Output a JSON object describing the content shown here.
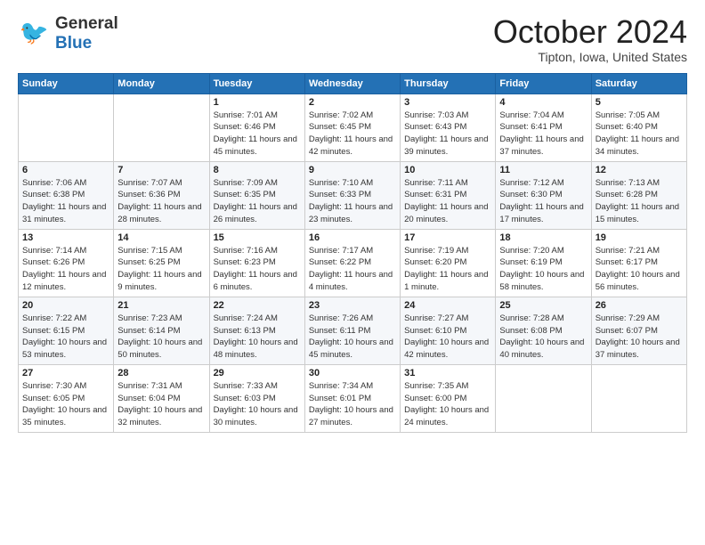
{
  "header": {
    "logo_general": "General",
    "logo_blue": "Blue",
    "month": "October 2024",
    "location": "Tipton, Iowa, United States"
  },
  "weekdays": [
    "Sunday",
    "Monday",
    "Tuesday",
    "Wednesday",
    "Thursday",
    "Friday",
    "Saturday"
  ],
  "weeks": [
    [
      {
        "day": "",
        "sunrise": "",
        "sunset": "",
        "daylight": ""
      },
      {
        "day": "",
        "sunrise": "",
        "sunset": "",
        "daylight": ""
      },
      {
        "day": "1",
        "sunrise": "Sunrise: 7:01 AM",
        "sunset": "Sunset: 6:46 PM",
        "daylight": "Daylight: 11 hours and 45 minutes."
      },
      {
        "day": "2",
        "sunrise": "Sunrise: 7:02 AM",
        "sunset": "Sunset: 6:45 PM",
        "daylight": "Daylight: 11 hours and 42 minutes."
      },
      {
        "day": "3",
        "sunrise": "Sunrise: 7:03 AM",
        "sunset": "Sunset: 6:43 PM",
        "daylight": "Daylight: 11 hours and 39 minutes."
      },
      {
        "day": "4",
        "sunrise": "Sunrise: 7:04 AM",
        "sunset": "Sunset: 6:41 PM",
        "daylight": "Daylight: 11 hours and 37 minutes."
      },
      {
        "day": "5",
        "sunrise": "Sunrise: 7:05 AM",
        "sunset": "Sunset: 6:40 PM",
        "daylight": "Daylight: 11 hours and 34 minutes."
      }
    ],
    [
      {
        "day": "6",
        "sunrise": "Sunrise: 7:06 AM",
        "sunset": "Sunset: 6:38 PM",
        "daylight": "Daylight: 11 hours and 31 minutes."
      },
      {
        "day": "7",
        "sunrise": "Sunrise: 7:07 AM",
        "sunset": "Sunset: 6:36 PM",
        "daylight": "Daylight: 11 hours and 28 minutes."
      },
      {
        "day": "8",
        "sunrise": "Sunrise: 7:09 AM",
        "sunset": "Sunset: 6:35 PM",
        "daylight": "Daylight: 11 hours and 26 minutes."
      },
      {
        "day": "9",
        "sunrise": "Sunrise: 7:10 AM",
        "sunset": "Sunset: 6:33 PM",
        "daylight": "Daylight: 11 hours and 23 minutes."
      },
      {
        "day": "10",
        "sunrise": "Sunrise: 7:11 AM",
        "sunset": "Sunset: 6:31 PM",
        "daylight": "Daylight: 11 hours and 20 minutes."
      },
      {
        "day": "11",
        "sunrise": "Sunrise: 7:12 AM",
        "sunset": "Sunset: 6:30 PM",
        "daylight": "Daylight: 11 hours and 17 minutes."
      },
      {
        "day": "12",
        "sunrise": "Sunrise: 7:13 AM",
        "sunset": "Sunset: 6:28 PM",
        "daylight": "Daylight: 11 hours and 15 minutes."
      }
    ],
    [
      {
        "day": "13",
        "sunrise": "Sunrise: 7:14 AM",
        "sunset": "Sunset: 6:26 PM",
        "daylight": "Daylight: 11 hours and 12 minutes."
      },
      {
        "day": "14",
        "sunrise": "Sunrise: 7:15 AM",
        "sunset": "Sunset: 6:25 PM",
        "daylight": "Daylight: 11 hours and 9 minutes."
      },
      {
        "day": "15",
        "sunrise": "Sunrise: 7:16 AM",
        "sunset": "Sunset: 6:23 PM",
        "daylight": "Daylight: 11 hours and 6 minutes."
      },
      {
        "day": "16",
        "sunrise": "Sunrise: 7:17 AM",
        "sunset": "Sunset: 6:22 PM",
        "daylight": "Daylight: 11 hours and 4 minutes."
      },
      {
        "day": "17",
        "sunrise": "Sunrise: 7:19 AM",
        "sunset": "Sunset: 6:20 PM",
        "daylight": "Daylight: 11 hours and 1 minute."
      },
      {
        "day": "18",
        "sunrise": "Sunrise: 7:20 AM",
        "sunset": "Sunset: 6:19 PM",
        "daylight": "Daylight: 10 hours and 58 minutes."
      },
      {
        "day": "19",
        "sunrise": "Sunrise: 7:21 AM",
        "sunset": "Sunset: 6:17 PM",
        "daylight": "Daylight: 10 hours and 56 minutes."
      }
    ],
    [
      {
        "day": "20",
        "sunrise": "Sunrise: 7:22 AM",
        "sunset": "Sunset: 6:15 PM",
        "daylight": "Daylight: 10 hours and 53 minutes."
      },
      {
        "day": "21",
        "sunrise": "Sunrise: 7:23 AM",
        "sunset": "Sunset: 6:14 PM",
        "daylight": "Daylight: 10 hours and 50 minutes."
      },
      {
        "day": "22",
        "sunrise": "Sunrise: 7:24 AM",
        "sunset": "Sunset: 6:13 PM",
        "daylight": "Daylight: 10 hours and 48 minutes."
      },
      {
        "day": "23",
        "sunrise": "Sunrise: 7:26 AM",
        "sunset": "Sunset: 6:11 PM",
        "daylight": "Daylight: 10 hours and 45 minutes."
      },
      {
        "day": "24",
        "sunrise": "Sunrise: 7:27 AM",
        "sunset": "Sunset: 6:10 PM",
        "daylight": "Daylight: 10 hours and 42 minutes."
      },
      {
        "day": "25",
        "sunrise": "Sunrise: 7:28 AM",
        "sunset": "Sunset: 6:08 PM",
        "daylight": "Daylight: 10 hours and 40 minutes."
      },
      {
        "day": "26",
        "sunrise": "Sunrise: 7:29 AM",
        "sunset": "Sunset: 6:07 PM",
        "daylight": "Daylight: 10 hours and 37 minutes."
      }
    ],
    [
      {
        "day": "27",
        "sunrise": "Sunrise: 7:30 AM",
        "sunset": "Sunset: 6:05 PM",
        "daylight": "Daylight: 10 hours and 35 minutes."
      },
      {
        "day": "28",
        "sunrise": "Sunrise: 7:31 AM",
        "sunset": "Sunset: 6:04 PM",
        "daylight": "Daylight: 10 hours and 32 minutes."
      },
      {
        "day": "29",
        "sunrise": "Sunrise: 7:33 AM",
        "sunset": "Sunset: 6:03 PM",
        "daylight": "Daylight: 10 hours and 30 minutes."
      },
      {
        "day": "30",
        "sunrise": "Sunrise: 7:34 AM",
        "sunset": "Sunset: 6:01 PM",
        "daylight": "Daylight: 10 hours and 27 minutes."
      },
      {
        "day": "31",
        "sunrise": "Sunrise: 7:35 AM",
        "sunset": "Sunset: 6:00 PM",
        "daylight": "Daylight: 10 hours and 24 minutes."
      },
      {
        "day": "",
        "sunrise": "",
        "sunset": "",
        "daylight": ""
      },
      {
        "day": "",
        "sunrise": "",
        "sunset": "",
        "daylight": ""
      }
    ]
  ]
}
